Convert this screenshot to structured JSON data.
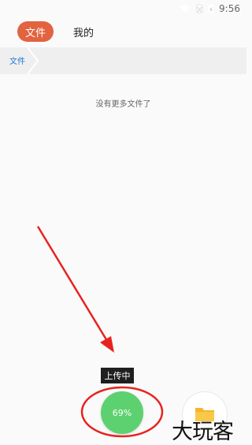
{
  "status_bar": {
    "time": "9:56"
  },
  "header": {
    "tabs": [
      {
        "label": "文件",
        "active": true
      },
      {
        "label": "我的",
        "active": false
      }
    ],
    "accent_color": "#e2633f"
  },
  "breadcrumb": {
    "items": [
      "文件"
    ]
  },
  "main": {
    "empty_message": "没有更多文件了"
  },
  "upload": {
    "tooltip": "上传中",
    "progress_label": "69%",
    "progress": 0.69,
    "color": "#5dd16f"
  },
  "watermark": {
    "text": "大玩客"
  }
}
